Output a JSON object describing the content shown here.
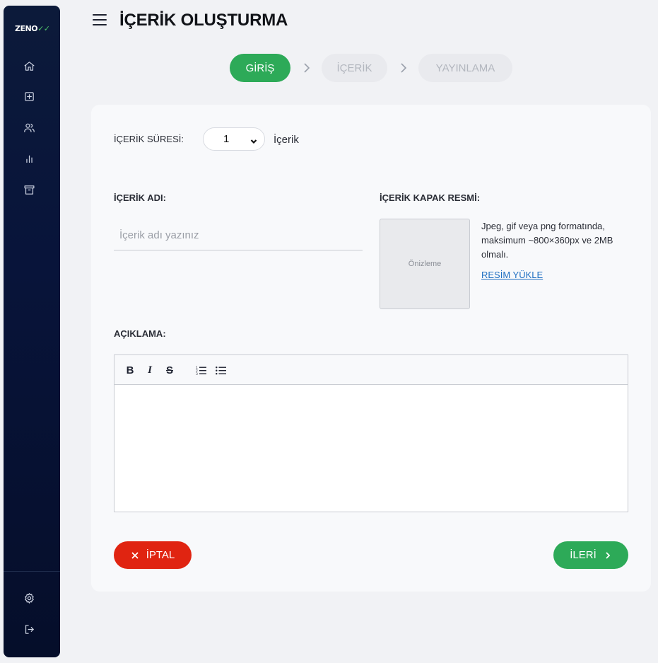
{
  "sidebar": {
    "logo_text": "ZENO",
    "logo_mark": "✓✓",
    "nav_icons": [
      "home-icon",
      "add-content-icon",
      "users-icon",
      "stats-icon",
      "archive-icon"
    ],
    "bottom_icons": [
      "settings-icon",
      "logout-icon"
    ]
  },
  "header": {
    "title": "İÇERİK OLUŞTURMA"
  },
  "steps": [
    {
      "label": "GİRİŞ",
      "state": "active"
    },
    {
      "label": "İÇERİK",
      "state": "inactive"
    },
    {
      "label": "YAYINLAMA",
      "state": "inactive"
    }
  ],
  "form": {
    "duration_label": "İÇERİK SÜRESİ:",
    "duration_value": "1",
    "duration_unit": "İçerik",
    "name_label": "İÇERİK ADI:",
    "name_placeholder": "İçerik adı yazınız",
    "name_value": "",
    "cover_label": "İÇERİK KAPAK RESMİ:",
    "preview_text": "Önizleme",
    "cover_info": "Jpeg, gif veya png formatında, maksimum ~800×360px ve 2MB olmalı.",
    "upload_link": "RESİM YÜKLE",
    "description_label": "AÇIKLAMA:",
    "editor_toolbar": {
      "bold": "B",
      "italic": "I",
      "strike": "S"
    },
    "description_value": ""
  },
  "actions": {
    "cancel_label": "İPTAL",
    "next_label": "İLERİ"
  },
  "colors": {
    "primary_green": "#2daa58",
    "danger_red": "#e02411",
    "sidebar_bg": "#0a1738",
    "link_blue": "#1f6fc2"
  }
}
